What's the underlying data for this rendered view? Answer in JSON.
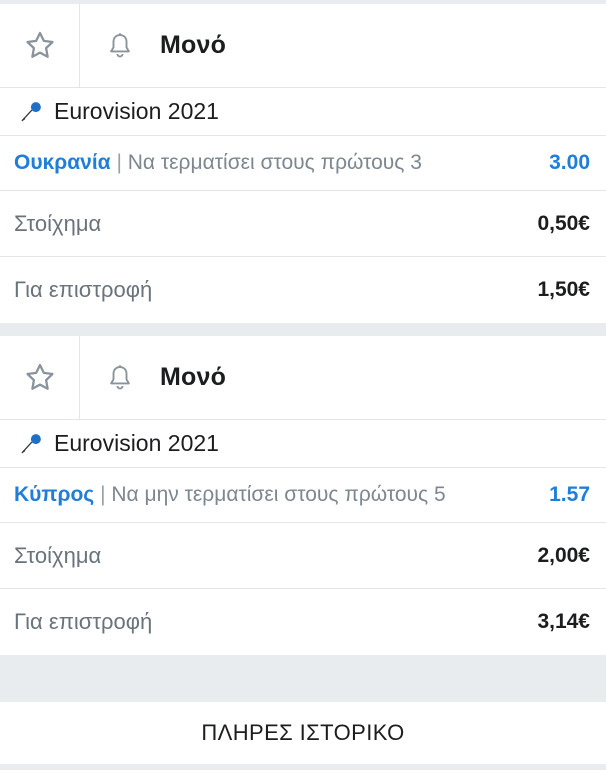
{
  "bets": [
    {
      "type": "Μονό",
      "event": "Eurovision 2021",
      "selection_team": "Ουκρανία",
      "separator": "|",
      "selection_market": "Να τερματίσει στους πρώτους 3",
      "odds": "3.00",
      "stake_label": "Στοίχημα",
      "stake_value": "0,50€",
      "return_label": "Για επιστροφή",
      "return_value": "1,50€"
    },
    {
      "type": "Μονό",
      "event": "Eurovision 2021",
      "selection_team": "Κύπρος",
      "separator": "|",
      "selection_market": "Να μην τερματίσει στους πρώτους 5",
      "odds": "1.57",
      "stake_label": "Στοίχημα",
      "stake_value": "2,00€",
      "return_label": "Για επιστροφή",
      "return_value": "3,14€"
    }
  ],
  "history_button": "ΠΛΗΡΕΣ ΙΣΤΟΡΙΚΟ",
  "icons": {
    "favorite": "star-outline-icon",
    "notify": "bell-outline-icon",
    "event": "microphone-icon"
  },
  "colors": {
    "accent": "#1f7ed9",
    "background": "#e8ecef",
    "card": "#ffffff",
    "muted_text": "#7d8790"
  }
}
